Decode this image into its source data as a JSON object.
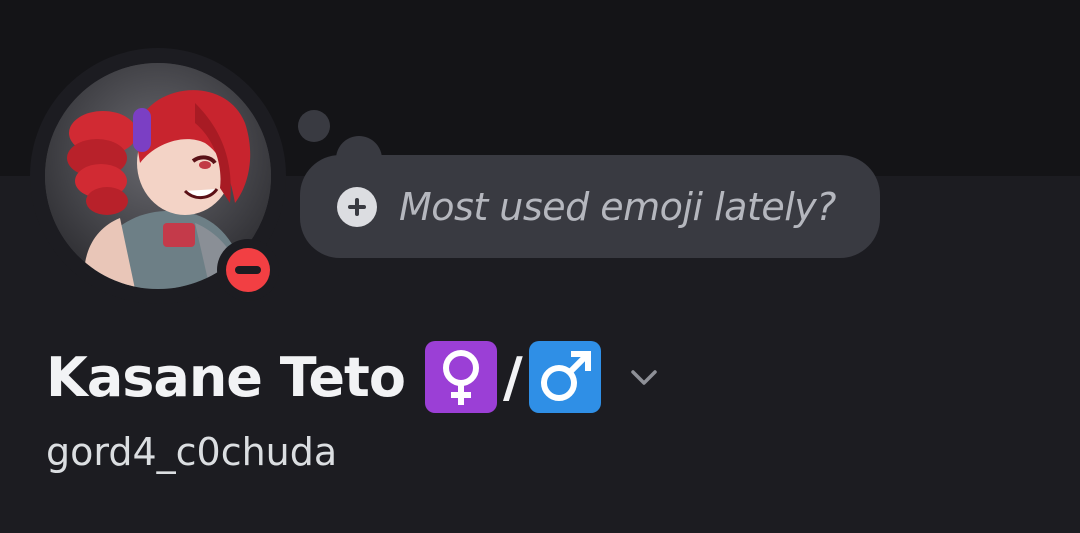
{
  "status_bubble": {
    "placeholder": "Most used emoji lately?",
    "add_icon": "plus-circle-icon"
  },
  "profile": {
    "display_name": "Kasane Teto",
    "name_emojis": [
      "female-sign-emoji",
      "male-sign-emoji"
    ],
    "emoji_separator": "/",
    "username": "gord4_c0chuda",
    "status": "do-not-disturb",
    "menu_icon": "chevron-down-icon"
  },
  "colors": {
    "background": "#1c1c21",
    "banner": "#141417",
    "bubble": "#393a41",
    "dnd_status": "#f23f43",
    "female_tile": "#9b3fd6",
    "male_tile": "#2f8fe6"
  }
}
